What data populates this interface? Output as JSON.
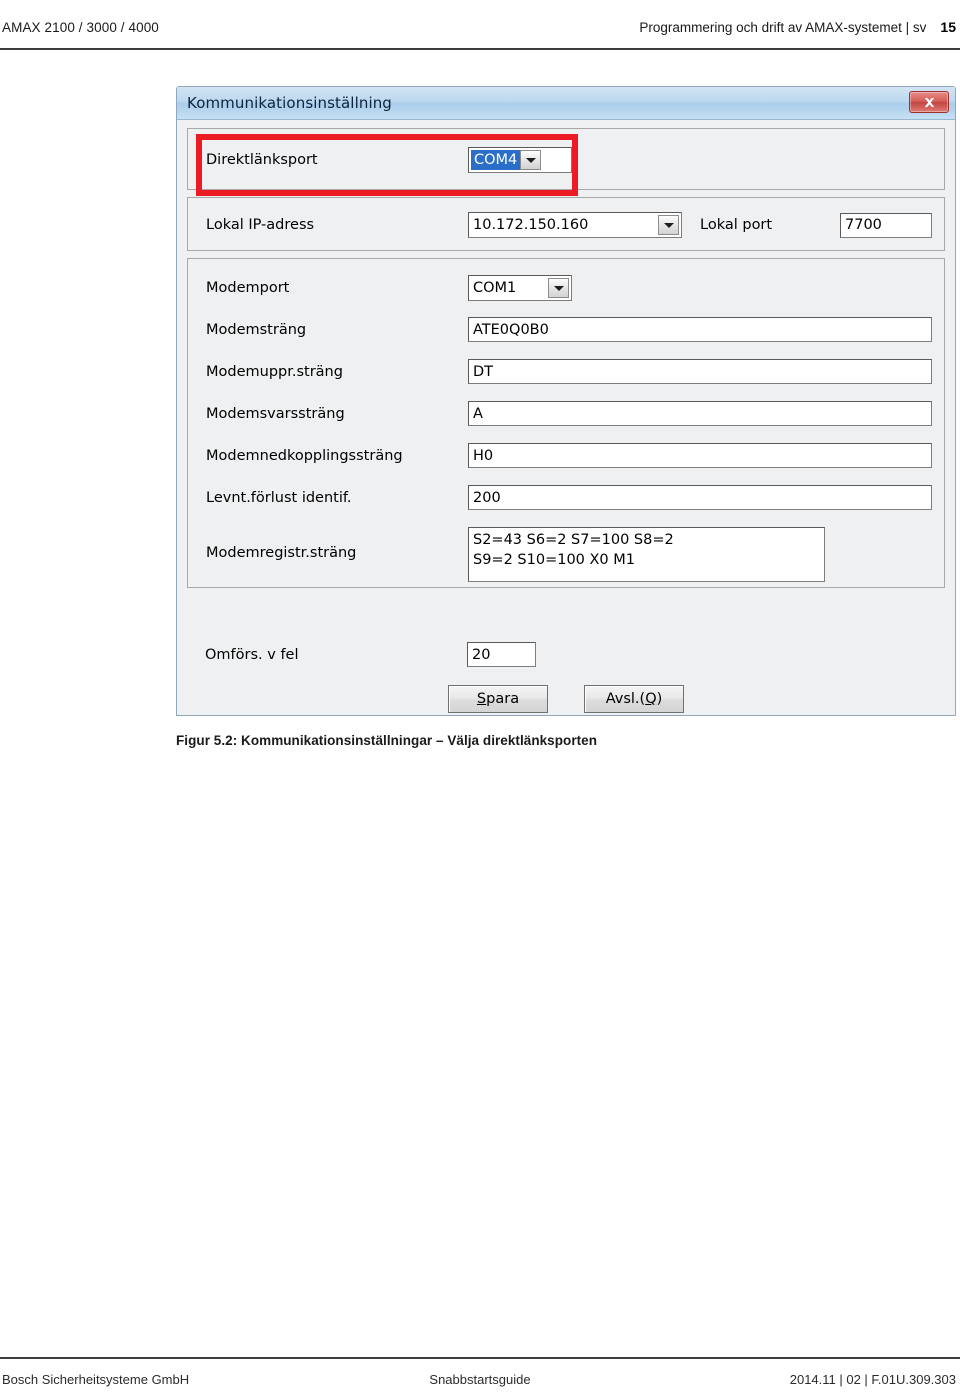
{
  "header": {
    "product": "AMAX 2100 / 3000 / 4000",
    "title": "Programmering och drift av AMAX-systemet | sv",
    "page_number": "15"
  },
  "dialog": {
    "title": "Kommunikationsinställning",
    "close_label": "x",
    "groups": {
      "direct_link": {
        "label": "Direktlänksport",
        "value": "COM4",
        "highlight_color": "#ed1c24"
      },
      "network": {
        "ip_label": "Lokal IP-adress",
        "ip_value": "10.172.150.160",
        "port_label": "Lokal port",
        "port_value": "7700"
      },
      "modem": {
        "port_label": "Modemport",
        "port_value": "COM1",
        "init_label": "Modemsträng",
        "init_value": "ATE0Q0B0",
        "dial_label": "Modemuppr.sträng",
        "dial_value": "DT",
        "answer_label": "Modemsvarssträng",
        "answer_value": "A",
        "hangup_label": "Modemnedkopplingssträng",
        "hangup_value": "H0",
        "carrier_loss_label": "Levnt.förlust identif.",
        "carrier_loss_value": "200",
        "register_label": "Modemregistr.sträng",
        "register_value": "S2=43 S6=2 S7=100 S8=2\nS9=2 S10=100 X0 M1"
      }
    },
    "retry": {
      "label": "Omförs. v fel",
      "value": "20"
    },
    "buttons": {
      "save": "Spara",
      "save_accel": "S",
      "save_rest": "para",
      "quit_pre": "Avsl.(",
      "quit_accel": "Q",
      "quit_post": ")"
    }
  },
  "caption": "Figur 5.2: Kommunikationsinställningar – Välja direktlänksporten",
  "footer": {
    "left": "Bosch Sicherheitsysteme GmbH",
    "center": "Snabbstartsguide",
    "right": "2014.11 | 02 | F.01U.309.303"
  }
}
